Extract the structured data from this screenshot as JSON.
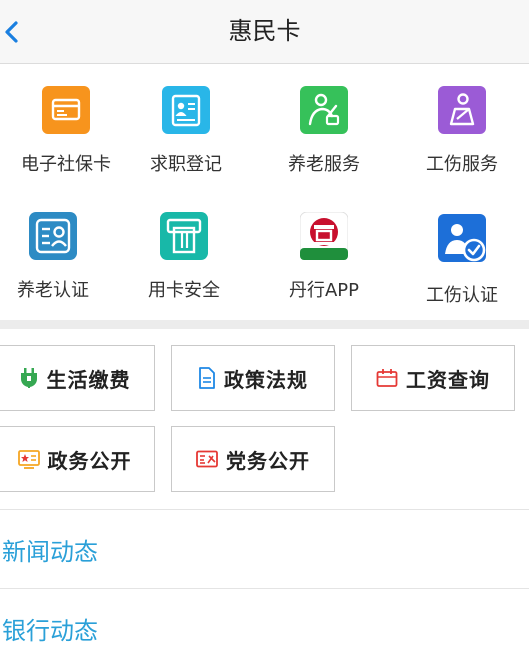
{
  "header": {
    "title": "惠民卡",
    "back_icon": "chevron-left-icon"
  },
  "services": [
    {
      "label": "电子社保卡",
      "icon": "social-security-card-icon",
      "color": "#f7941d"
    },
    {
      "label": "求职登记",
      "icon": "job-registration-icon",
      "color": "#29b6e8"
    },
    {
      "label": "养老服务",
      "icon": "elderly-service-icon",
      "color": "#36c15a"
    },
    {
      "label": "工伤服务",
      "icon": "work-injury-service-icon",
      "color": "#9b5bd6"
    },
    {
      "label": "养老认证",
      "icon": "pension-verification-icon",
      "color": "#2d8bc4"
    },
    {
      "label": "用卡安全",
      "icon": "card-security-icon",
      "color": "#18b8a8"
    },
    {
      "label": "丹行APP",
      "icon": "bank-app-icon",
      "color": "#c8102e"
    },
    {
      "label": "工伤认证",
      "icon": "injury-verification-icon",
      "color": "#1d6fd8"
    }
  ],
  "tiles": [
    {
      "label": "生活缴费",
      "icon": "utility-payment-icon",
      "color": "#36a852"
    },
    {
      "label": "政策法规",
      "icon": "document-icon",
      "color": "#1e88e5"
    },
    {
      "label": "工资查询",
      "icon": "salary-query-icon",
      "color": "#e53935"
    },
    {
      "label": "政务公开",
      "icon": "government-affairs-icon",
      "color": "#f5a623"
    },
    {
      "label": "党务公开",
      "icon": "party-affairs-icon",
      "color": "#e53935"
    }
  ],
  "news": [
    {
      "label": "新闻动态"
    },
    {
      "label": "银行动态"
    }
  ],
  "colors": {
    "link": "#2aa0d8",
    "nav_back": "#1a7fe0"
  }
}
